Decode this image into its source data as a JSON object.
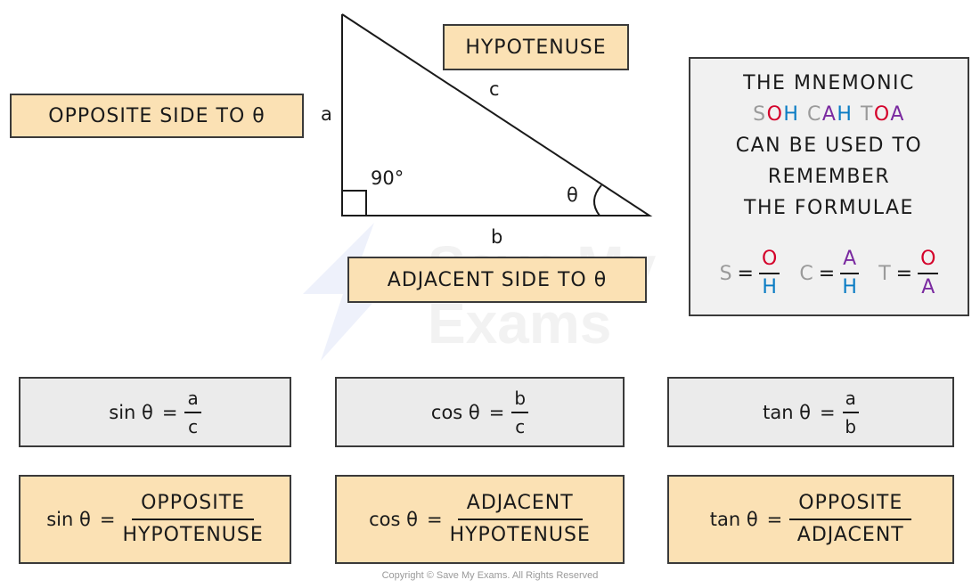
{
  "diagram": {
    "labels": {
      "opposite": "OPPOSITE  SIDE  TO  θ",
      "hypotenuse": "HYPOTENUSE",
      "adjacent": "ADJACENT  SIDE  TO  θ"
    },
    "triangle": {
      "side_a": "a",
      "side_b": "b",
      "side_c": "c",
      "right_angle": "90°",
      "angle": "θ"
    },
    "watermark": {
      "line1": "Save My",
      "line2": "Exams"
    }
  },
  "mnemonic": {
    "line1": "THE  MNEMONIC",
    "soh": [
      {
        "t": "S",
        "c": "grey"
      },
      {
        "t": "O",
        "c": "red"
      },
      {
        "t": "H",
        "c": "blue"
      }
    ],
    "cah": [
      {
        "t": "C",
        "c": "grey"
      },
      {
        "t": "A",
        "c": "purple"
      },
      {
        "t": "H",
        "c": "blue"
      }
    ],
    "toa": [
      {
        "t": "T",
        "c": "grey"
      },
      {
        "t": "O",
        "c": "red"
      },
      {
        "t": "A",
        "c": "purple"
      }
    ],
    "line3": "CAN  BE  USED  TO",
    "line4": "REMEMBER",
    "line5": "THE  FORMULAE",
    "fractions": [
      {
        "lhs": "S",
        "num": "O",
        "den": "H"
      },
      {
        "lhs": "C",
        "num": "A",
        "den": "H"
      },
      {
        "lhs": "T",
        "num": "O",
        "den": "A"
      }
    ],
    "colors": {
      "grey": "#9a9a9a",
      "red": "#d4002a",
      "blue": "#0a7cc4",
      "purple": "#7a2aa0"
    }
  },
  "formulas_letters": [
    {
      "fn": "sin θ",
      "eq": "=",
      "num": "a",
      "den": "c"
    },
    {
      "fn": "cos θ",
      "eq": "=",
      "num": "b",
      "den": "c"
    },
    {
      "fn": "tan θ",
      "eq": "=",
      "num": "a",
      "den": "b"
    }
  ],
  "formulas_words": [
    {
      "fn": "sin θ",
      "eq": "=",
      "num": "OPPOSITE",
      "den": "HYPOTENUSE"
    },
    {
      "fn": "cos θ",
      "eq": "=",
      "num": "ADJACENT",
      "den": "HYPOTENUSE"
    },
    {
      "fn": "tan θ",
      "eq": "=",
      "num": "OPPOSITE",
      "den": "ADJACENT"
    }
  ],
  "copyright": "Copyright © Save My Exams. All Rights Reserved",
  "fill_colors": {
    "tan": "#fbe1b4",
    "grey": "#ebebeb"
  }
}
